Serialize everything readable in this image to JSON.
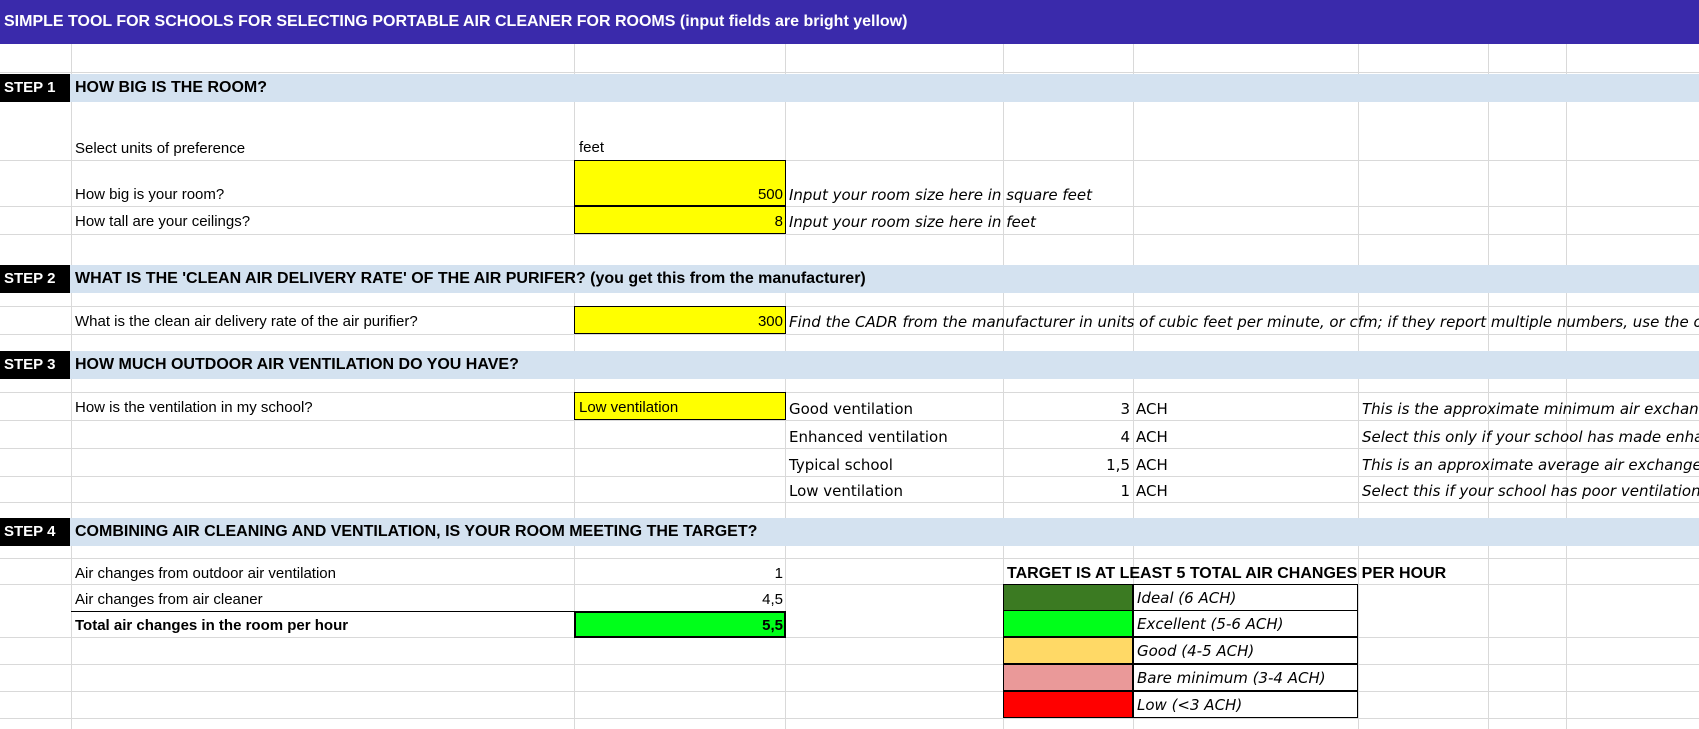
{
  "title": "SIMPLE TOOL FOR SCHOOLS FOR SELECTING PORTABLE AIR CLEANER FOR ROOMS (input fields are bright yellow)",
  "step1": {
    "tag": "STEP 1",
    "heading": "HOW BIG IS THE ROOM?",
    "units_label": "Select units of preference",
    "units_value": "feet",
    "room_size_label": "How big is your room?",
    "room_size_value": "500",
    "room_size_hint": "Input your room size here in square feet",
    "ceiling_label": "How tall are your ceilings?",
    "ceiling_value": "8",
    "ceiling_hint": "Input your room size here in feet"
  },
  "step2": {
    "tag": "STEP 2",
    "heading": "WHAT IS THE 'CLEAN AIR DELIVERY RATE' OF THE AIR PURIFER? (you get this from the manufacturer)",
    "cadr_label": "What is the clean air delivery rate of the air purifier?",
    "cadr_value": "300",
    "cadr_hint": "Find the CADR from the manufacturer in units of cubic feet per minute, or cfm; if they report multiple numbers, use the one"
  },
  "step3": {
    "tag": "STEP 3",
    "heading": "HOW MUCH OUTDOOR AIR VENTILATION DO YOU HAVE?",
    "ventilation_label": "How is the ventilation in my school?",
    "ventilation_value": "Low ventilation",
    "options": [
      {
        "name": "Good ventilation",
        "ach": "3",
        "unit": "ACH",
        "note": "This is the approximate minimum air exchange"
      },
      {
        "name": "Enhanced ventilation",
        "ach": "4",
        "unit": "ACH",
        "note": "Select this only if your school has made enhanc"
      },
      {
        "name": "Typical school",
        "ach": "1,5",
        "unit": "ACH",
        "note": "This is an approximate average air exchange ra"
      },
      {
        "name": "Low ventilation",
        "ach": "1",
        "unit": "ACH",
        "note": "Select this if your school has poor ventilation or"
      }
    ]
  },
  "step4": {
    "tag": "STEP 4",
    "heading": "COMBINING AIR CLEANING AND VENTILATION, IS YOUR ROOM MEETING THE TARGET?",
    "outdoor_label": "Air changes from outdoor air ventilation",
    "outdoor_value": "1",
    "cleaner_label": "Air changes from air cleaner",
    "cleaner_value": "4,5",
    "total_label": "Total air changes in the room per hour",
    "total_value": "5,5",
    "total_color": "#00ff1a",
    "target_heading": "TARGET IS AT LEAST 5 TOTAL AIR CHANGES PER HOUR",
    "legend": [
      {
        "label": "Ideal (6 ACH)",
        "color": "#3b7a22"
      },
      {
        "label": "Excellent (5-6 ACH)",
        "color": "#00ff1a"
      },
      {
        "label": "Good (4-5 ACH)",
        "color": "#ffd966"
      },
      {
        "label": "Bare minimum (3-4 ACH)",
        "color": "#ea9999"
      },
      {
        "label": "Low (<3 ACH)",
        "color": "#ff0000"
      }
    ]
  }
}
